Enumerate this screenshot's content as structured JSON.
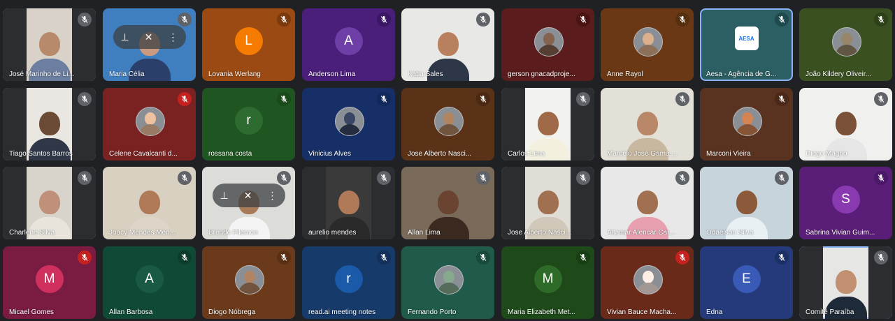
{
  "colors": {
    "mic_muted_bg": "#c5221f",
    "active_border": "#8ab4f8"
  },
  "tiles": [
    {
      "name": "José Marinho de Li...",
      "kind": "video",
      "bg": "#d8d2c8",
      "skin": "#b88a6c",
      "shirt": "#6c7fa0",
      "mic": "#5f6368"
    },
    {
      "name": "Maria Célia",
      "kind": "video",
      "bg": "#3f7fbf",
      "skin": "#c99a80",
      "shirt": "#2a3f6a",
      "mic": "#5f6368",
      "hover": true
    },
    {
      "name": "Lovania Werlang",
      "kind": "initial",
      "bg": "#9a4a12",
      "avatarColor": "#f57c00",
      "initial": "L",
      "mic": "#7a3a0e"
    },
    {
      "name": "Anderson Lima",
      "kind": "initial",
      "bg": "#4a1f7a",
      "avatarColor": "#6f3fa8",
      "initial": "A",
      "mic": "#3a1764"
    },
    {
      "name": "Kátia Sales",
      "kind": "video",
      "bg": "#e8e8e6",
      "skin": "#b98060",
      "shirt": "#2d3748",
      "mic": "#5f6368"
    },
    {
      "name": "gerson gnacadproje...",
      "kind": "photo",
      "bg": "#5a1c1c",
      "photoColor": "#7a5a48",
      "mic": "#4a1414"
    },
    {
      "name": "Anne Rayol",
      "kind": "photo",
      "bg": "#6a3814",
      "photoColor": "#c8a080",
      "mic": "#55300f"
    },
    {
      "name": "Aesa - Agência de G...",
      "kind": "logo",
      "bg": "#2b5f63",
      "logoText": "AESA",
      "mic": "#1f4a4d",
      "active": true
    },
    {
      "name": "João Kildery Oliveir...",
      "kind": "photo",
      "bg": "#3a5020",
      "photoColor": "#8a7a60",
      "mic": "#2e4018"
    },
    {
      "name": "Tiago Santos Barros",
      "kind": "video",
      "bg": "#eae7e2",
      "skin": "#6b4a36",
      "shirt": "#303848",
      "mic": "#5f6368"
    },
    {
      "name": "Celene Cavalcanti d...",
      "kind": "photo",
      "bg": "#7a2222",
      "photoColor": "#d8b090",
      "mic": "#c5221f"
    },
    {
      "name": "rossana costa",
      "kind": "initial",
      "bg": "#1e5520",
      "avatarColor": "#2e6b30",
      "initial": "r",
      "mic": "#1a4a1c"
    },
    {
      "name": "Vinicius Alves",
      "kind": "photo",
      "bg": "#162f66",
      "photoColor": "#34405a",
      "mic": "#11285a"
    },
    {
      "name": "Jose Alberto Nasci...",
      "kind": "photo",
      "bg": "#5a3218",
      "photoColor": "#a07858",
      "mic": "#4a2812"
    },
    {
      "name": "Carlos Lima",
      "kind": "video",
      "bg": "#f2f2ee",
      "skin": "#a06a48",
      "shirt": "#f3f0e0",
      "mic": "#5f6368"
    },
    {
      "name": "Marcelo José Gama ...",
      "kind": "video",
      "bg": "#e3e0d8",
      "skin": "#b88868",
      "shirt": "#c8b8a0",
      "mic": "#5f6368"
    },
    {
      "name": "Marconi Vieira",
      "kind": "photo",
      "bg": "#5a3220",
      "photoColor": "#c0784a",
      "mic": "#4a2818"
    },
    {
      "name": "Diego Magno",
      "kind": "video",
      "bg": "#f0f0ee",
      "skin": "#7a5038",
      "shirt": "#e6e6e6",
      "mic": "#5f6368"
    },
    {
      "name": "Charlene Silva",
      "kind": "video",
      "bg": "#d8d4cc",
      "skin": "#c0907a",
      "shirt": "#e8e4dc",
      "mic": "#5f6368"
    },
    {
      "name": "Joacy Mendes Men...",
      "kind": "video",
      "bg": "#d8d0c0",
      "skin": "#b07a58",
      "shirt": "#ddd6c8",
      "mic": "#5f6368"
    },
    {
      "name": "Brendo Filemon",
      "kind": "video",
      "bg": "#dcdcd8",
      "skin": "#a87a58",
      "shirt": "#f4f4f4",
      "mic": "#5f6368",
      "hover": true
    },
    {
      "name": "aurelio mendes",
      "kind": "video",
      "bg": "#3a3a3a",
      "skin": "#b07a58",
      "shirt": "#2a2a2a",
      "mic": "#5f6368"
    },
    {
      "name": "Allan Lima",
      "kind": "video",
      "bg": "#7a6a5a",
      "skin": "#6a4430",
      "shirt": "#3a2a20",
      "mic": "#5f6368"
    },
    {
      "name": "Jose Alberto Nasci...",
      "kind": "video",
      "bg": "#e0ddd6",
      "skin": "#a07050",
      "shirt": "#d0c8b8",
      "mic": "#5f6368"
    },
    {
      "name": "Altamar Alencar Car...",
      "kind": "video",
      "bg": "#e8e8e8",
      "skin": "#a07050",
      "shirt": "#e8a0b0",
      "mic": "#5f6368"
    },
    {
      "name": "Odaelson Silva",
      "kind": "video",
      "bg": "#c8d4dc",
      "skin": "#8a5a3a",
      "shirt": "#e8f0f4",
      "mic": "#5f6368"
    },
    {
      "name": "Sabrina Vivian Guim...",
      "kind": "initial",
      "bg": "#5a1e78",
      "avatarColor": "#8a3ab0",
      "initial": "S",
      "mic": "#4a1866"
    },
    {
      "name": "Micael Gomes",
      "kind": "initial",
      "bg": "#7a1c42",
      "avatarColor": "#d0305e",
      "initial": "M",
      "mic": "#c5221f"
    },
    {
      "name": "Allan Barbosa",
      "kind": "initial",
      "bg": "#0f4a36",
      "avatarColor": "#1a5a44",
      "initial": "A",
      "mic": "#0c3c2c"
    },
    {
      "name": "Diogo Nóbrega",
      "kind": "photo",
      "bg": "#6a3a1a",
      "photoColor": "#a0785a",
      "mic": "#5a3014"
    },
    {
      "name": "read.ai meeting notes",
      "kind": "initial",
      "bg": "#163a6a",
      "avatarColor": "#1a5aa8",
      "initial": "r",
      "mic": "#12305a"
    },
    {
      "name": "Fernando Porto",
      "kind": "photo",
      "bg": "#1f5a4a",
      "photoColor": "#7a9a80",
      "mic": "#184a3c"
    },
    {
      "name": "Maria Elizabeth Met...",
      "kind": "initial",
      "bg": "#1e4a1a",
      "avatarColor": "#2e6a28",
      "initial": "M",
      "mic": "#183e14"
    },
    {
      "name": "Vivian Bauce Macha...",
      "kind": "photo",
      "bg": "#6a2a1a",
      "photoColor": "#e8d8d0",
      "mic": "#c5221f"
    },
    {
      "name": "Edna",
      "kind": "initial",
      "bg": "#243a7a",
      "avatarColor": "#3a5ab8",
      "initial": "E",
      "mic": "#1c3066"
    },
    {
      "name": "Comitê Paraíba",
      "kind": "video",
      "bg": "#e6e6e4",
      "skin": "#c09070",
      "shirt": "#1f2a38",
      "mic": "#5f6368",
      "active": true
    }
  ]
}
